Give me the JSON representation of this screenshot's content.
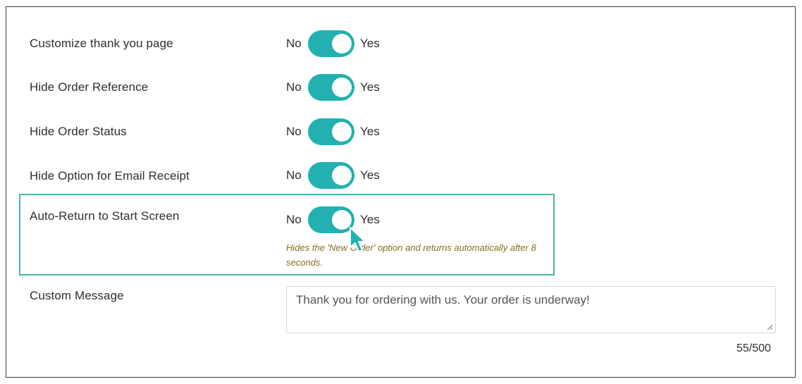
{
  "settings": [
    {
      "label": "Customize thank you page",
      "no": "No",
      "yes": "Yes",
      "on": true
    },
    {
      "label": "Hide Order Reference",
      "no": "No",
      "yes": "Yes",
      "on": true
    },
    {
      "label": "Hide Order Status",
      "no": "No",
      "yes": "Yes",
      "on": true
    },
    {
      "label": "Hide Option for Email Receipt",
      "no": "No",
      "yes": "Yes",
      "on": true
    },
    {
      "label": "Auto-Return to Start Screen",
      "no": "No",
      "yes": "Yes",
      "on": true,
      "hint": "Hides the 'New Order' option and returns automatically after 8 seconds."
    }
  ],
  "custom_message": {
    "label": "Custom Message",
    "value": "Thank you for ordering with us. Your order is underway!",
    "counter": "55/500"
  },
  "colors": {
    "toggle_on": "#22b1b0",
    "highlight_border": "#45b5ad",
    "hint_text": "#8a6a1a"
  }
}
